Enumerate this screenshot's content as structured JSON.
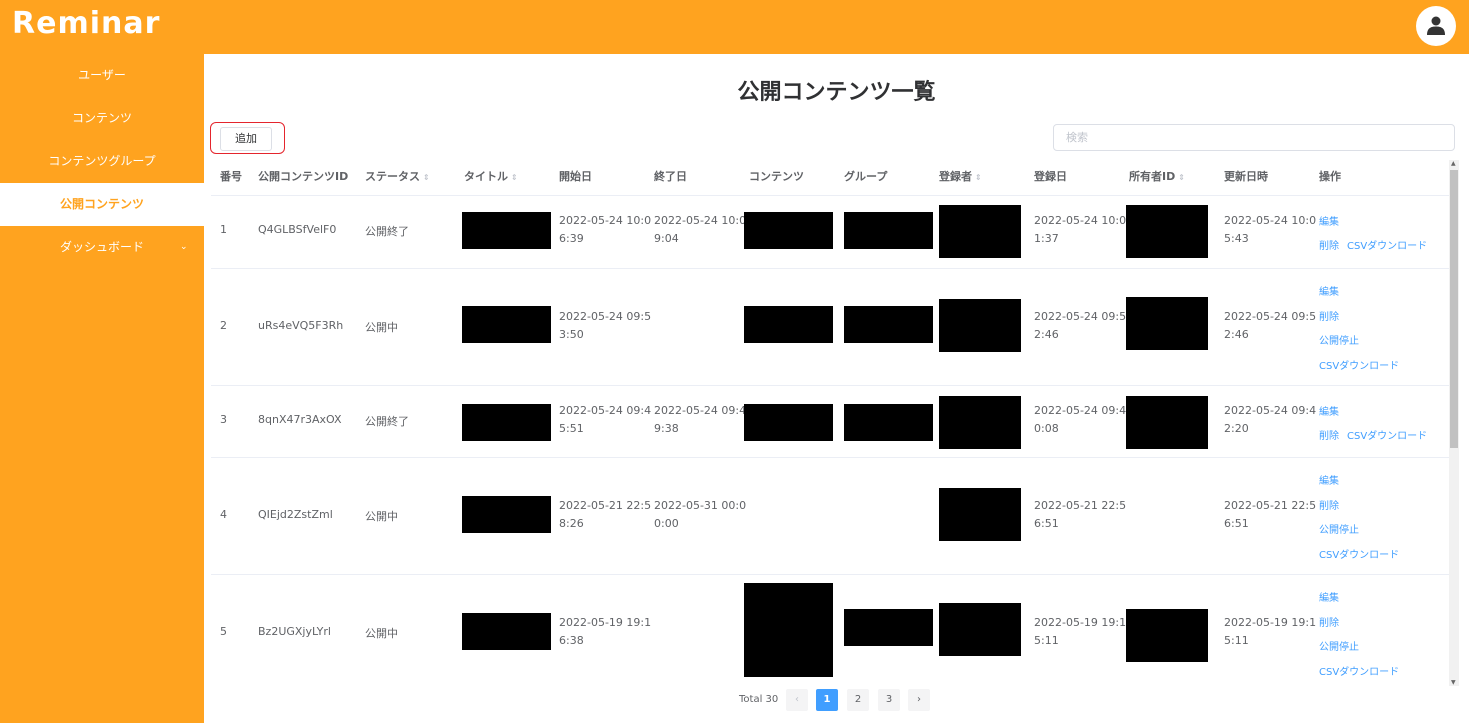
{
  "app": {
    "logo": "Reminar"
  },
  "sidebar": {
    "items": [
      {
        "label": "ユーザー"
      },
      {
        "label": "コンテンツ"
      },
      {
        "label": "コンテンツグループ"
      },
      {
        "label": "公開コンテンツ"
      },
      {
        "label": "ダッシュボード",
        "chevron": "⌄"
      }
    ]
  },
  "main": {
    "title": "公開コンテンツ一覧",
    "add_label": "追加",
    "search_placeholder": "検索"
  },
  "table": {
    "columns": [
      "番号",
      "公開コンテンツID",
      "ステータス",
      "タイトル",
      "開始日",
      "終了日",
      "コンテンツ",
      "グループ",
      "登録者",
      "登録日",
      "所有者ID",
      "更新日時",
      "操作"
    ],
    "sort_icon": "⇕",
    "rows": [
      {
        "no": "1",
        "id": "Q4GLBSfVelF0",
        "status": "公開終了",
        "start": [
          "2022-05-24 10:0",
          "6:39"
        ],
        "end": [
          "2022-05-24 10:0",
          "9:04"
        ],
        "reg": [
          "2022-05-24 10:0",
          "1:37"
        ],
        "upd": [
          "2022-05-24 10:0",
          "5:43"
        ],
        "actions": [
          "編集",
          "削除",
          "CSVダウンロード"
        ]
      },
      {
        "no": "2",
        "id": "uRs4eVQ5F3Rh",
        "status": "公開中",
        "start": [
          "2022-05-24 09:5",
          "3:50"
        ],
        "end": [
          "",
          ""
        ],
        "reg": [
          "2022-05-24 09:5",
          "2:46"
        ],
        "upd": [
          "2022-05-24 09:5",
          "2:46"
        ],
        "actions": [
          "編集",
          "削除",
          "公開停止",
          "CSVダウンロード"
        ]
      },
      {
        "no": "3",
        "id": "8qnX47r3AxOX",
        "status": "公開終了",
        "start": [
          "2022-05-24 09:4",
          "5:51"
        ],
        "end": [
          "2022-05-24 09:4",
          "9:38"
        ],
        "reg": [
          "2022-05-24 09:4",
          "0:08"
        ],
        "upd": [
          "2022-05-24 09:4",
          "2:20"
        ],
        "actions": [
          "編集",
          "削除",
          "CSVダウンロード"
        ]
      },
      {
        "no": "4",
        "id": "QIEjd2ZstZml",
        "status": "公開中",
        "start": [
          "2022-05-21 22:5",
          "8:26"
        ],
        "end": [
          "2022-05-31 00:0",
          "0:00"
        ],
        "reg": [
          "2022-05-21 22:5",
          "6:51"
        ],
        "upd": [
          "2022-05-21 22:5",
          "6:51"
        ],
        "actions": [
          "編集",
          "削除",
          "公開停止",
          "CSVダウンロード"
        ]
      },
      {
        "no": "5",
        "id": "Bz2UGXjyLYrl",
        "status": "公開中",
        "start": [
          "2022-05-19 19:1",
          "6:38"
        ],
        "end": [
          "",
          ""
        ],
        "reg": [
          "2022-05-19 19:1",
          "5:11"
        ],
        "upd": [
          "2022-05-19 19:1",
          "5:11"
        ],
        "actions": [
          "編集",
          "削除",
          "公開停止",
          "CSVダウンロード"
        ]
      }
    ]
  },
  "pagination": {
    "total": "Total 30",
    "prev": "‹",
    "next": "›",
    "pages": [
      "1",
      "2",
      "3"
    ]
  },
  "colors": {
    "brand": "#FFA31F",
    "link": "#409EFF",
    "highlight": "#e4252d"
  },
  "icons": {
    "avatar": "user-icon",
    "sort": "sort-icon",
    "chevron": "chevron-down-icon"
  }
}
